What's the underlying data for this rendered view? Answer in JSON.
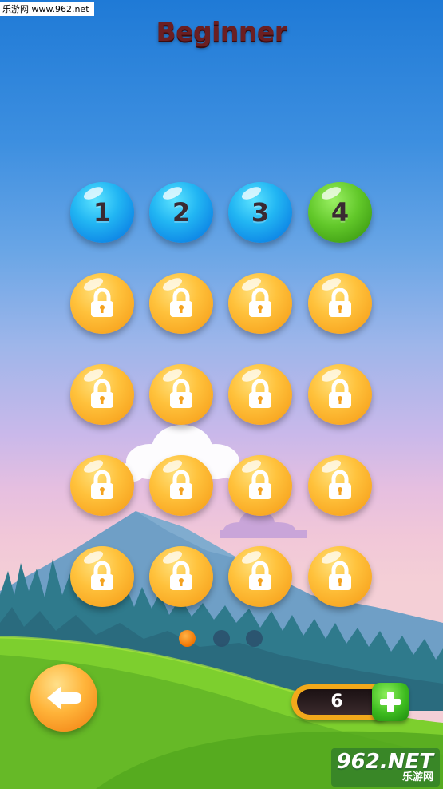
{
  "watermark_top": "乐游网 www.962.net",
  "title": "Beginner",
  "levels": [
    {
      "label": "1",
      "state": "unlocked",
      "color": "blue"
    },
    {
      "label": "2",
      "state": "unlocked",
      "color": "blue"
    },
    {
      "label": "3",
      "state": "unlocked",
      "color": "blue"
    },
    {
      "label": "4",
      "state": "current",
      "color": "green"
    },
    {
      "label": "",
      "state": "locked",
      "icon": "lock-icon"
    },
    {
      "label": "",
      "state": "locked",
      "icon": "lock-icon"
    },
    {
      "label": "",
      "state": "locked",
      "icon": "lock-icon"
    },
    {
      "label": "",
      "state": "locked",
      "icon": "lock-icon"
    },
    {
      "label": "",
      "state": "locked",
      "icon": "lock-icon"
    },
    {
      "label": "",
      "state": "locked",
      "icon": "lock-icon"
    },
    {
      "label": "",
      "state": "locked",
      "icon": "lock-icon"
    },
    {
      "label": "",
      "state": "locked",
      "icon": "lock-icon"
    },
    {
      "label": "",
      "state": "locked",
      "icon": "lock-icon"
    },
    {
      "label": "",
      "state": "locked",
      "icon": "lock-icon"
    },
    {
      "label": "",
      "state": "locked",
      "icon": "lock-icon"
    },
    {
      "label": "",
      "state": "locked",
      "icon": "lock-icon"
    },
    {
      "label": "",
      "state": "locked",
      "icon": "lock-icon"
    },
    {
      "label": "",
      "state": "locked",
      "icon": "lock-icon"
    },
    {
      "label": "",
      "state": "locked",
      "icon": "lock-icon"
    },
    {
      "label": "",
      "state": "locked",
      "icon": "lock-icon"
    }
  ],
  "pagination": {
    "pages": 3,
    "current": 1
  },
  "back_button": {
    "icon": "back-arrow-icon"
  },
  "counter": {
    "value": "6",
    "add_icon": "plus-icon"
  },
  "watermark_bottom": {
    "big": "962.NET",
    "small": "乐游网"
  },
  "colors": {
    "title": "#6b1f22",
    "blue": "#22b6f3",
    "green": "#62c82a",
    "locked": "#ffc23c",
    "sky_top": "#1f7ad6",
    "grass": "#7ad12e"
  }
}
